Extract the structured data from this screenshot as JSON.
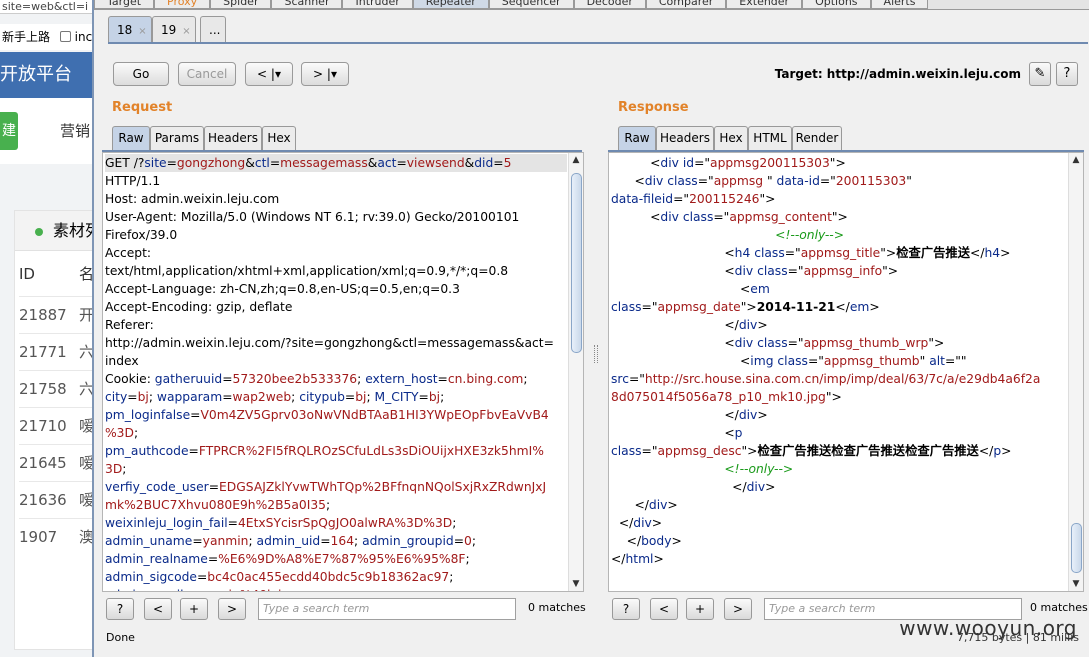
{
  "background": {
    "url": "site=web&ctl=i",
    "bookmark1": "新手上路",
    "bookmark2": "inc",
    "platform_title": "开放平台",
    "green_button": "建",
    "menu": "营销",
    "panel_title": "素材列",
    "col_id": "ID",
    "col_name": "名",
    "rows": [
      {
        "id": "21887",
        "name": "开"
      },
      {
        "id": "21771",
        "name": "六"
      },
      {
        "id": "21758",
        "name": "六"
      },
      {
        "id": "21710",
        "name": "嗳"
      },
      {
        "id": "21645",
        "name": "嗳"
      },
      {
        "id": "21636",
        "name": "嗳"
      },
      {
        "id": "1907",
        "name": "澳"
      }
    ]
  },
  "tool_tabs": [
    "Target",
    "Proxy",
    "Spider",
    "Scanner",
    "Intruder",
    "Repeater",
    "Sequencer",
    "Decoder",
    "Comparer",
    "Extender",
    "Options",
    "Alerts"
  ],
  "request_tabs": [
    {
      "label": "18",
      "close": "×"
    },
    {
      "label": "19",
      "close": "×"
    },
    {
      "label": "...",
      "close": ""
    }
  ],
  "toolbar": {
    "go": "Go",
    "cancel": "Cancel",
    "back": "< |▾",
    "forward": "> |▾",
    "target": "Target: http://admin.weixin.leju.com",
    "edit_icon": "✎",
    "help_icon": "?"
  },
  "request": {
    "title": "Request",
    "tabs": [
      "Raw",
      "Params",
      "Headers",
      "Hex"
    ]
  },
  "response": {
    "title": "Response",
    "tabs": [
      "Raw",
      "Headers",
      "Hex",
      "HTML",
      "Render"
    ]
  },
  "search": {
    "help": "?",
    "prev": "<",
    "add": "+",
    "next": ">",
    "placeholder": "Type a search term",
    "matches": "0 matches"
  },
  "status": "Done",
  "bytes": "7,715 bytes | 81 millis",
  "watermark": "www.wooyun.org"
}
